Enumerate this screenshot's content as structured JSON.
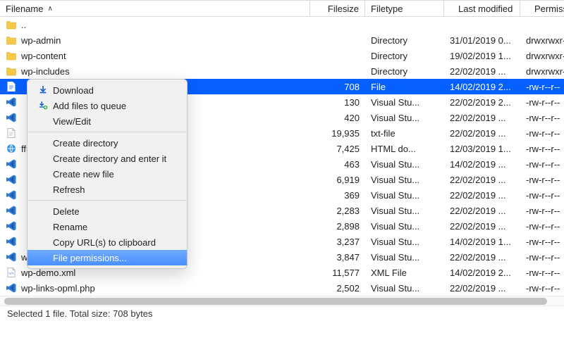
{
  "columns": {
    "filename": "Filename",
    "filesize": "Filesize",
    "filetype": "Filetype",
    "modified": "Last modified",
    "permissions": "Permissions"
  },
  "rows": [
    {
      "icon": "folder",
      "name": "..",
      "size": "",
      "type": "",
      "modified": "",
      "perm": ""
    },
    {
      "icon": "folder",
      "name": "wp-admin",
      "size": "",
      "type": "Directory",
      "modified": "31/01/2019 0...",
      "perm": "drwxrwxr-x"
    },
    {
      "icon": "folder",
      "name": "wp-content",
      "size": "",
      "type": "Directory",
      "modified": "19/02/2019 1...",
      "perm": "drwxrwxr-x"
    },
    {
      "icon": "folder",
      "name": "wp-includes",
      "size": "",
      "type": "Directory",
      "modified": "22/02/2019 ...",
      "perm": "drwxrwxr-x"
    },
    {
      "icon": "file",
      "name": "",
      "size": "708",
      "type": "File",
      "modified": "14/02/2019 2...",
      "perm": "-rw-r--r--",
      "selected": true
    },
    {
      "icon": "vscode",
      "name": "",
      "size": "130",
      "type": "Visual Stu...",
      "modified": "22/02/2019 2...",
      "perm": "-rw-r--r--"
    },
    {
      "icon": "vscode",
      "name": "",
      "size": "420",
      "type": "Visual Stu...",
      "modified": "22/02/2019 ...",
      "perm": "-rw-r--r--"
    },
    {
      "icon": "file",
      "name": "",
      "size": "19,935",
      "type": "txt-file",
      "modified": "22/02/2019 ...",
      "perm": "-rw-r--r--"
    },
    {
      "icon": "html",
      "name": "ff5eb17861.html",
      "size": "7,425",
      "type": "HTML do...",
      "modified": "12/03/2019 1...",
      "perm": "-rw-r--r--"
    },
    {
      "icon": "vscode",
      "name": "",
      "size": "463",
      "type": "Visual Stu...",
      "modified": "14/02/2019 ...",
      "perm": "-rw-r--r--"
    },
    {
      "icon": "vscode",
      "name": "",
      "size": "6,919",
      "type": "Visual Stu...",
      "modified": "22/02/2019 ...",
      "perm": "-rw-r--r--"
    },
    {
      "icon": "vscode",
      "name": "",
      "size": "369",
      "type": "Visual Stu...",
      "modified": "22/02/2019 ...",
      "perm": "-rw-r--r--"
    },
    {
      "icon": "vscode",
      "name": "",
      "size": "2,283",
      "type": "Visual Stu...",
      "modified": "22/02/2019 ...",
      "perm": "-rw-r--r--"
    },
    {
      "icon": "vscode",
      "name": "",
      "size": "2,898",
      "type": "Visual Stu...",
      "modified": "22/02/2019 ...",
      "perm": "-rw-r--r--"
    },
    {
      "icon": "vscode",
      "name": "",
      "size": "3,237",
      "type": "Visual Stu...",
      "modified": "14/02/2019 1...",
      "perm": "-rw-r--r--"
    },
    {
      "icon": "vscode",
      "name": "wp-cron.php",
      "size": "3,847",
      "type": "Visual Stu...",
      "modified": "22/02/2019 ...",
      "perm": "-rw-r--r--"
    },
    {
      "icon": "xml",
      "name": "wp-demo.xml",
      "size": "11,577",
      "type": "XML File",
      "modified": "14/02/2019 2...",
      "perm": "-rw-r--r--"
    },
    {
      "icon": "vscode",
      "name": "wp-links-opml.php",
      "size": "2,502",
      "type": "Visual Stu...",
      "modified": "22/02/2019 ...",
      "perm": "-rw-r--r--"
    }
  ],
  "context_menu": {
    "download": "Download",
    "add_to_queue": "Add files to queue",
    "view_edit": "View/Edit",
    "create_dir": "Create directory",
    "create_dir_enter": "Create directory and enter it",
    "create_file": "Create new file",
    "refresh": "Refresh",
    "delete": "Delete",
    "rename": "Rename",
    "copy_urls": "Copy URL(s) to clipboard",
    "file_permissions": "File permissions..."
  },
  "status_bar": "Selected 1 file. Total size: 708 bytes"
}
